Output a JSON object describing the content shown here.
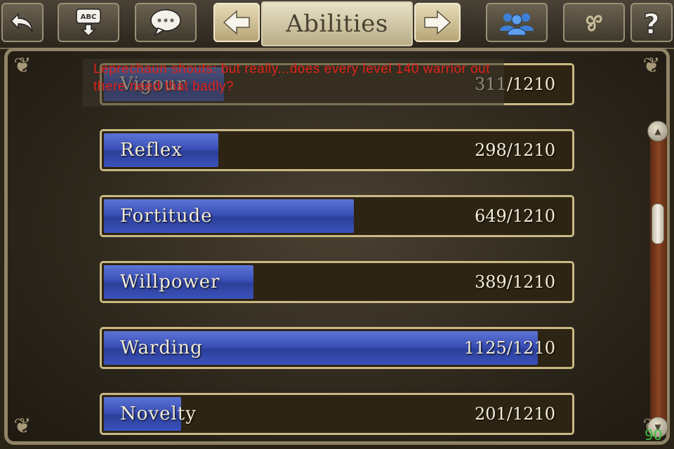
{
  "header": {
    "title": "Abilities"
  },
  "toolbar": {
    "back_icon": "undo-arrow-icon",
    "abc_icon": "abc-download-icon",
    "chat_icon": "speech-bubble-icon",
    "prev_icon": "arrow-left-icon",
    "next_icon": "arrow-right-icon",
    "group_icon": "people-group-icon",
    "triskele_icon": "triskele-icon",
    "help_icon": "question-mark-icon"
  },
  "chat": {
    "message": "Leprechaun shouts: but really...does every level 140 warrior out there need that badly?",
    "color": "#e0221a"
  },
  "stats": [
    {
      "name": "Vigour",
      "value": "311/1210",
      "fraction": 0.257
    },
    {
      "name": "Reflex",
      "value": "298/1210",
      "fraction": 0.246
    },
    {
      "name": "Fortitude",
      "value": "649/1210",
      "fraction": 0.536
    },
    {
      "name": "Willpower",
      "value": "389/1210",
      "fraction": 0.321
    },
    {
      "name": "Warding",
      "value": "1125/1210",
      "fraction": 0.93
    },
    {
      "name": "Novelty",
      "value": "201/1210",
      "fraction": 0.166
    }
  ],
  "scroll": {
    "position": 0.25
  },
  "fps": "90",
  "colors": {
    "bar_fill": "#3a50b8",
    "bar_border": "#c9b985",
    "fps_text": "#3fbf3f"
  }
}
